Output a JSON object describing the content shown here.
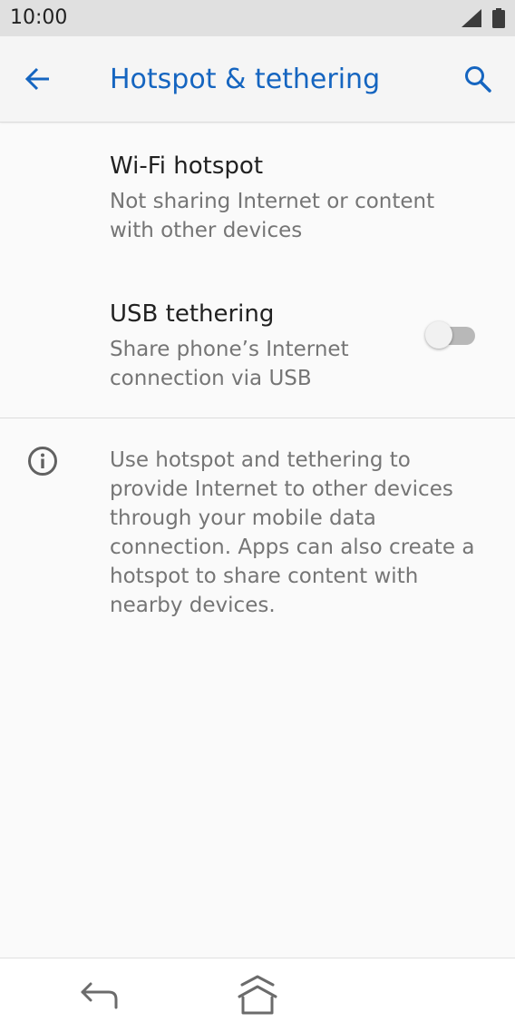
{
  "status_bar": {
    "time": "10:00"
  },
  "app_bar": {
    "title": "Hotspot & tethering"
  },
  "preferences": [
    {
      "title": "Wi-Fi hotspot",
      "summary": "Not sharing Internet or content with other devices"
    },
    {
      "title": "USB tethering",
      "summary": "Share phone’s Internet connection via USB",
      "toggle_on": false
    }
  ],
  "footer_info": {
    "text": "Use hotspot and tethering to provide Internet to other devices through your mobile data connection. Apps can also create a hotspot to share content with nearby devices."
  },
  "icons": {
    "status": [
      "signal-icon",
      "battery-icon"
    ],
    "app_bar": [
      "back-arrow-icon",
      "search-icon"
    ],
    "info": "info-icon",
    "nav": [
      "nav-back-icon",
      "nav-home-icon"
    ]
  },
  "colors": {
    "accent": "#1565c0",
    "status_bar_bg": "#e0e0e0",
    "app_bar_bg": "#f5f5f5",
    "background": "#fafafa",
    "title_text": "#212121",
    "summary_text": "#757575",
    "toggle_track_off": "#b8b8b8",
    "toggle_thumb_off": "#f1f1f1"
  }
}
